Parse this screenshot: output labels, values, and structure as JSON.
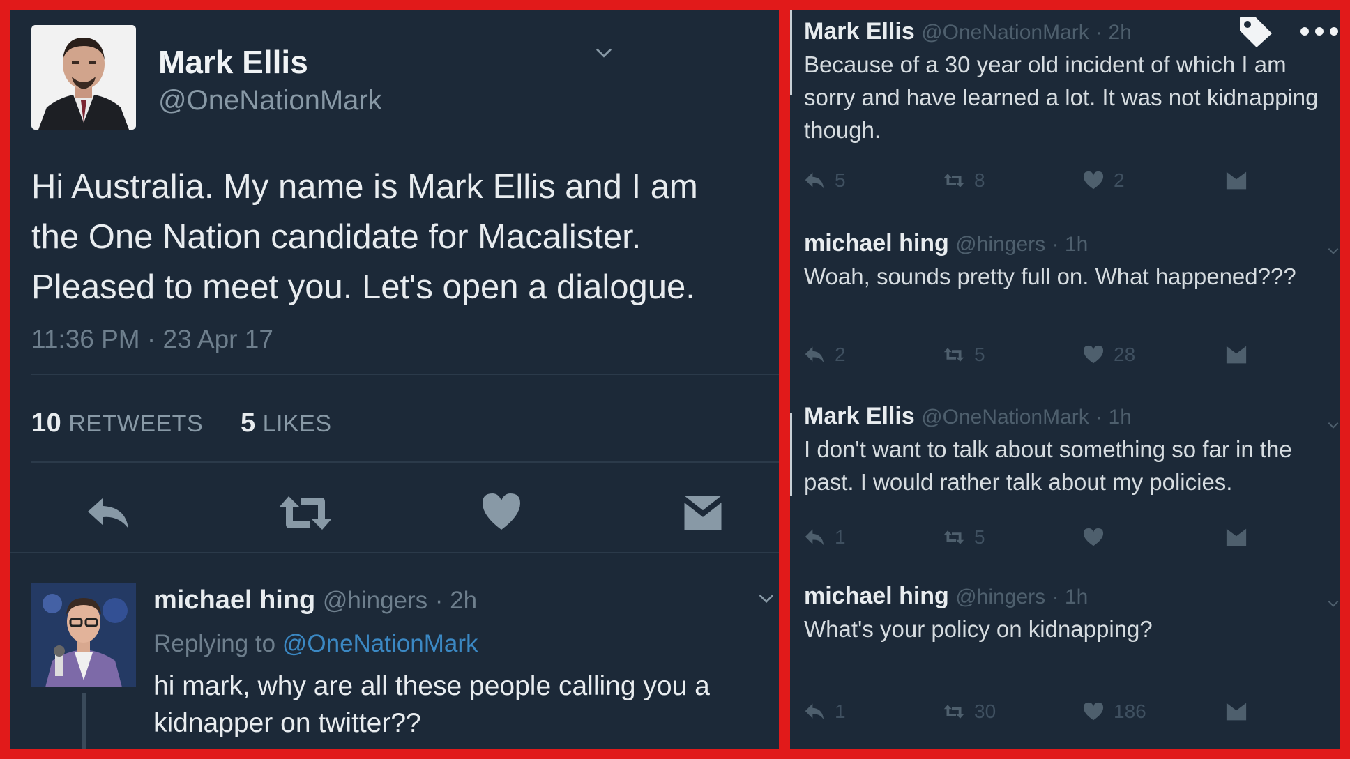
{
  "main_tweet": {
    "author_name": "Mark Ellis",
    "author_handle": "@OneNationMark",
    "text": "Hi Australia. My name is Mark Ellis and I am\nthe One Nation candidate for Macalister.\nPleased to meet you. Let's open a dialogue.",
    "timestamp": "11:36 PM · 23 Apr 17",
    "retweets_count": "10",
    "retweets_label": "RETWEETS",
    "likes_count": "5",
    "likes_label": "LIKES"
  },
  "reply": {
    "author_name": "michael hing",
    "author_handle": "@hingers",
    "time": "· 2h",
    "replying_prefix": "Replying to",
    "replying_mention": "@OneNationMark",
    "text": "hi mark, why are all these people calling you a kidnapper on twitter??"
  },
  "thread": [
    {
      "author_name": "Mark Ellis",
      "author_handle": "@OneNationMark",
      "time": "· 2h",
      "text": "Because of a 30 year old incident of which I am sorry and have learned a lot. It was not kidnapping though.",
      "replies": "5",
      "retweets": "8",
      "likes": "2"
    },
    {
      "author_name": "michael hing",
      "author_handle": "@hingers",
      "time": "· 1h",
      "text": "Woah, sounds pretty full on. What happened???",
      "replies": "2",
      "retweets": "5",
      "likes": "28"
    },
    {
      "author_name": "Mark Ellis",
      "author_handle": "@OneNationMark",
      "time": "· 1h",
      "text": "I don't want to talk about something so far in the past. I would rather talk about my policies.",
      "replies": "1",
      "retweets": "5",
      "likes": ""
    },
    {
      "author_name": "michael hing",
      "author_handle": "@hingers",
      "time": "· 1h",
      "text": "What's your policy on kidnapping?",
      "replies": "1",
      "retweets": "30",
      "likes": "186"
    }
  ],
  "icons": {
    "reply": "reply-icon",
    "retweet": "retweet-icon",
    "like": "heart-icon",
    "dm": "envelope-icon",
    "tag": "tag-icon",
    "more": "more-icon",
    "chevron": "chevron-down-icon"
  },
  "colors": {
    "frame": "#e11a1a",
    "background": "#1c2938",
    "mention": "#3b88c3",
    "muted": "#8899a6"
  }
}
